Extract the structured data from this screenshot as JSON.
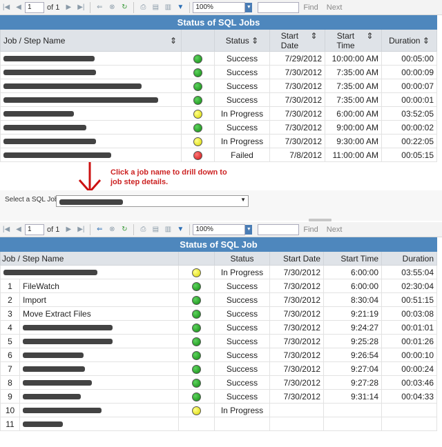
{
  "toolbar1": {
    "page": "1",
    "of_text": "of 1",
    "zoom": "100%",
    "find": "Find",
    "next": "Next"
  },
  "toolbar2": {
    "page": "1",
    "of_text": "of 1",
    "zoom": "100%",
    "find": "Find",
    "next": "Next"
  },
  "jobs_report": {
    "title": "Status of SQL Jobs",
    "headers": {
      "name": "Job / Step Name",
      "status": "Status",
      "start_date": "Start Date",
      "start_time": "Start Time",
      "duration": "Duration"
    },
    "rows": [
      {
        "name": "",
        "indicator": "green",
        "status": "Success",
        "start_date": "7/29/2012",
        "start_time": "10:00:00 AM",
        "duration": "00:05:00"
      },
      {
        "name": "",
        "indicator": "green",
        "status": "Success",
        "start_date": "7/30/2012",
        "start_time": "7:35:00 AM",
        "duration": "00:00:09"
      },
      {
        "name": "",
        "indicator": "green",
        "status": "Success",
        "start_date": "7/30/2012",
        "start_time": "7:35:00 AM",
        "duration": "00:00:07"
      },
      {
        "name": "",
        "indicator": "green",
        "status": "Success",
        "start_date": "7/30/2012",
        "start_time": "7:35:00 AM",
        "duration": "00:00:01"
      },
      {
        "name": "",
        "indicator": "yellow",
        "status": "In Progress",
        "start_date": "7/30/2012",
        "start_time": "6:00:00 AM",
        "duration": "03:52:05"
      },
      {
        "name": "",
        "indicator": "green",
        "status": "Success",
        "start_date": "7/30/2012",
        "start_time": "9:00:00 AM",
        "duration": "00:00:02"
      },
      {
        "name": "",
        "indicator": "yellow",
        "status": "In Progress",
        "start_date": "7/30/2012",
        "start_time": "9:30:00 AM",
        "duration": "00:22:05"
      },
      {
        "name": "",
        "indicator": "red",
        "status": "Failed",
        "start_date": "7/8/2012",
        "start_time": "11:00:00 AM",
        "duration": "00:05:15"
      }
    ]
  },
  "annotation": "Click a job name to drill down to job step details.",
  "job_selector": {
    "label": "Select a SQL Job",
    "value": ""
  },
  "steps_report": {
    "title": "Status of SQL Job",
    "headers": {
      "name": "Job / Step Name",
      "status": "Status",
      "start_date": "Start Date",
      "start_time": "Start Time",
      "duration": "Duration"
    },
    "job_row": {
      "name": "",
      "indicator": "yellow",
      "status": "In Progress",
      "start_date": "7/30/2012",
      "start_time": "6:00:00",
      "duration": "03:55:04"
    },
    "rows": [
      {
        "num": "1",
        "name": "FileWatch",
        "indicator": "green",
        "status": "Success",
        "start_date": "7/30/2012",
        "start_time": "6:00:00",
        "duration": "02:30:04"
      },
      {
        "num": "2",
        "name": "Import",
        "indicator": "green",
        "status": "Success",
        "start_date": "7/30/2012",
        "start_time": "8:30:04",
        "duration": "00:51:15"
      },
      {
        "num": "3",
        "name": "Move Extract Files",
        "indicator": "green",
        "status": "Success",
        "start_date": "7/30/2012",
        "start_time": "9:21:19",
        "duration": "00:03:08"
      },
      {
        "num": "4",
        "name": "",
        "indicator": "green",
        "status": "Success",
        "start_date": "7/30/2012",
        "start_time": "9:24:27",
        "duration": "00:01:01"
      },
      {
        "num": "5",
        "name": "",
        "indicator": "green",
        "status": "Success",
        "start_date": "7/30/2012",
        "start_time": "9:25:28",
        "duration": "00:01:26"
      },
      {
        "num": "6",
        "name": "",
        "indicator": "green",
        "status": "Success",
        "start_date": "7/30/2012",
        "start_time": "9:26:54",
        "duration": "00:00:10"
      },
      {
        "num": "7",
        "name": "",
        "indicator": "green",
        "status": "Success",
        "start_date": "7/30/2012",
        "start_time": "9:27:04",
        "duration": "00:00:24"
      },
      {
        "num": "8",
        "name": "",
        "indicator": "green",
        "status": "Success",
        "start_date": "7/30/2012",
        "start_time": "9:27:28",
        "duration": "00:03:46"
      },
      {
        "num": "9",
        "name": "",
        "indicator": "green",
        "status": "Success",
        "start_date": "7/30/2012",
        "start_time": "9:31:14",
        "duration": "00:04:33"
      },
      {
        "num": "10",
        "name": "",
        "indicator": "yellow",
        "status": "In Progress",
        "start_date": "",
        "start_time": "",
        "duration": ""
      },
      {
        "num": "11",
        "name": "",
        "indicator": "",
        "status": "",
        "start_date": "",
        "start_time": "",
        "duration": ""
      }
    ]
  }
}
